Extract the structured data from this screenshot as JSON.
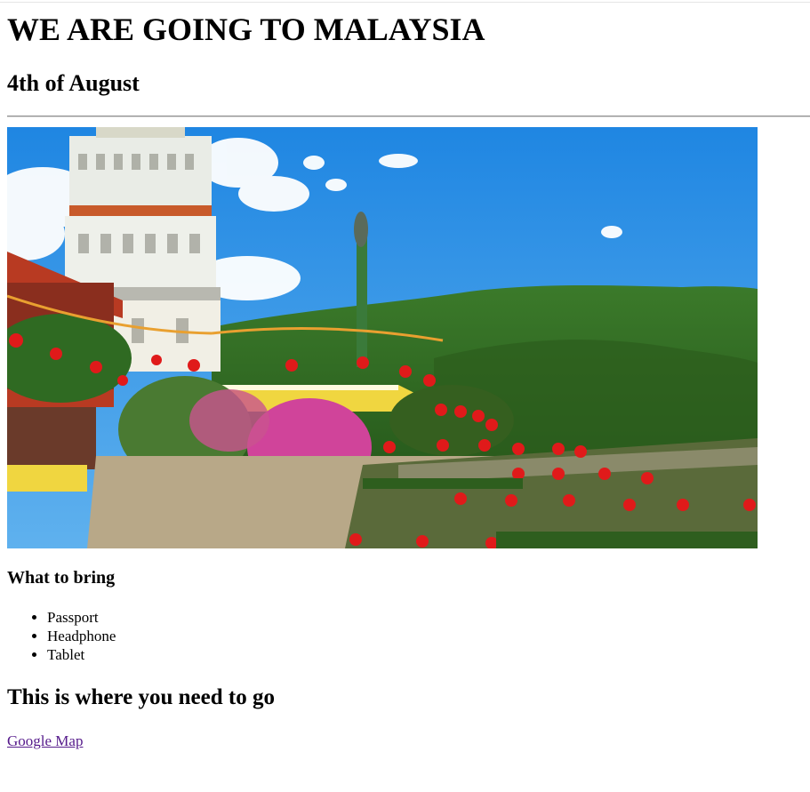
{
  "header": {
    "title": "WE ARE GOING TO MALAYSIA",
    "date": "4th of August"
  },
  "hero_image": {
    "subject": "Kek Lok Si temple with pagoda, red lanterns, bougainvillea and green hills under blue sky",
    "colors": {
      "sky": "#2f8fe0",
      "hills": "#2f6a22",
      "pagoda": "#e9ece6",
      "roof": "#b83a22",
      "wall": "#f0d640",
      "lantern": "#e01a1a",
      "flowers": "#d0449a"
    }
  },
  "packing": {
    "heading": "What to bring",
    "items": [
      "Passport",
      "Headphone",
      "Tablet"
    ]
  },
  "location": {
    "heading": "This is where you need to go",
    "link_label": "Google Map"
  }
}
